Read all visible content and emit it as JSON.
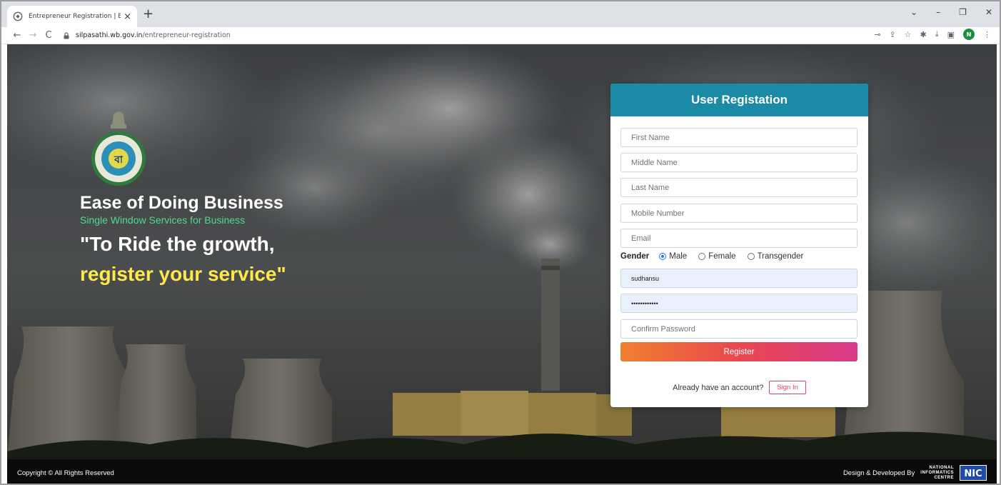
{
  "browser": {
    "tab_title": "Entrepreneur Registration | Ease",
    "tab_close": "×",
    "new_tab": "+",
    "url_host": "silpasathi.wb.gov.in",
    "url_path": "/entrepreneur-registration",
    "profile_initial": "N",
    "window_controls": [
      "⌄",
      "–",
      "❐",
      "✕"
    ]
  },
  "hero": {
    "title": "Ease of Doing Business",
    "subtitle": "Single Window Services for Business",
    "quote_line1": "\"To Ride the growth,",
    "quote_line2": "register your service\""
  },
  "form": {
    "title": "User Registation",
    "first_name_placeholder": "First Name",
    "middle_name_placeholder": "Middle Name",
    "last_name_placeholder": "Last Name",
    "mobile_placeholder": "Mobile Number",
    "email_placeholder": "Email",
    "gender_label": "Gender",
    "gender_options": [
      "Male",
      "Female",
      "Transgender"
    ],
    "gender_selected": "Male",
    "username_value": "sudhansu",
    "password_value": "••••••••••••",
    "confirm_password_placeholder": "Confirm Password",
    "register_label": "Register",
    "have_account_text": "Already have an account?",
    "signin_label": "Sign In"
  },
  "footer": {
    "copyright": "Copyright © All Rights Reserved",
    "developed_by": "Design & Developed By",
    "nic_line1": "NATIONAL",
    "nic_line2": "INFORMATICS",
    "nic_line3": "CENTRE",
    "nic_logo_text": "NIC"
  },
  "colors": {
    "header_teal": "#1b8aa7",
    "subtitle_green": "#4cdb8d",
    "quote_yellow": "#ffe94a",
    "register_gradient_start": "#f07f2f",
    "register_gradient_end": "#d83a8b"
  }
}
